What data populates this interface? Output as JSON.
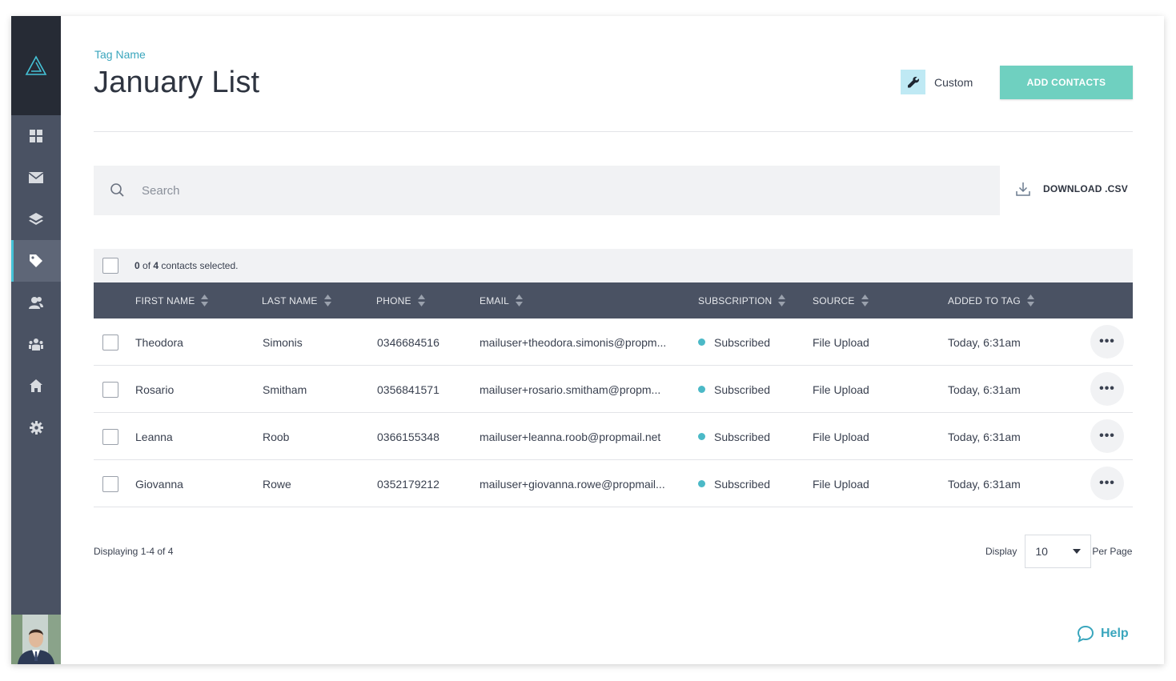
{
  "header": {
    "breadcrumb": "Tag Name",
    "title": "January List",
    "custom_label": "Custom",
    "custom_icon": "wrench-icon",
    "add_button": "ADD CONTACTS"
  },
  "sidebar": {
    "logo_icon": "triangle-logo-icon",
    "items": [
      {
        "name": "dashboard",
        "icon": "grid-icon",
        "active": false
      },
      {
        "name": "mail",
        "icon": "envelope-icon",
        "active": false
      },
      {
        "name": "layers",
        "icon": "layers-icon",
        "active": false
      },
      {
        "name": "tags",
        "icon": "tag-icon",
        "active": true
      },
      {
        "name": "contacts",
        "icon": "contacts-icon",
        "active": false
      },
      {
        "name": "team",
        "icon": "team-icon",
        "active": false
      },
      {
        "name": "properties",
        "icon": "home-icon",
        "active": false
      },
      {
        "name": "settings",
        "icon": "gear-icon",
        "active": false
      }
    ]
  },
  "search": {
    "placeholder": "Search",
    "value": ""
  },
  "download": {
    "label": "DOWNLOAD .CSV"
  },
  "selection": {
    "selected": "0",
    "of": "of",
    "total": "4",
    "suffix": "contacts selected."
  },
  "table": {
    "columns": [
      "FIRST NAME",
      "LAST NAME",
      "PHONE",
      "EMAIL",
      "SUBSCRIPTION",
      "SOURCE",
      "ADDED TO TAG"
    ],
    "rows": [
      {
        "first": "Theodora",
        "last": "Simonis",
        "phone": "0346684516",
        "email": "mailuser+theodora.simonis@propm...",
        "subscription": "Subscribed",
        "source": "File Upload",
        "added": "Today, 6:31am"
      },
      {
        "first": "Rosario",
        "last": "Smitham",
        "phone": "0356841571",
        "email": "mailuser+rosario.smitham@propm...",
        "subscription": "Subscribed",
        "source": "File Upload",
        "added": "Today, 6:31am"
      },
      {
        "first": "Leanna",
        "last": "Roob",
        "phone": "0366155348",
        "email": "mailuser+leanna.roob@propmail.net",
        "subscription": "Subscribed",
        "source": "File Upload",
        "added": "Today, 6:31am"
      },
      {
        "first": "Giovanna",
        "last": "Rowe",
        "phone": "0352179212",
        "email": "mailuser+giovanna.rowe@propmail...",
        "subscription": "Subscribed",
        "source": "File Upload",
        "added": "Today, 6:31am"
      }
    ],
    "more_label": "•••"
  },
  "footer": {
    "displaying": "Displaying 1-4 of 4",
    "display_label": "Display",
    "per_page_value": "10",
    "per_page_label": "Per Page"
  },
  "help": {
    "label": "Help"
  },
  "colors": {
    "accent": "#3aa6bd",
    "button": "#6fd0c0",
    "sidebar": "#4a5263",
    "sidebar_dark": "#262b35",
    "status_dot": "#4bb9c7"
  }
}
